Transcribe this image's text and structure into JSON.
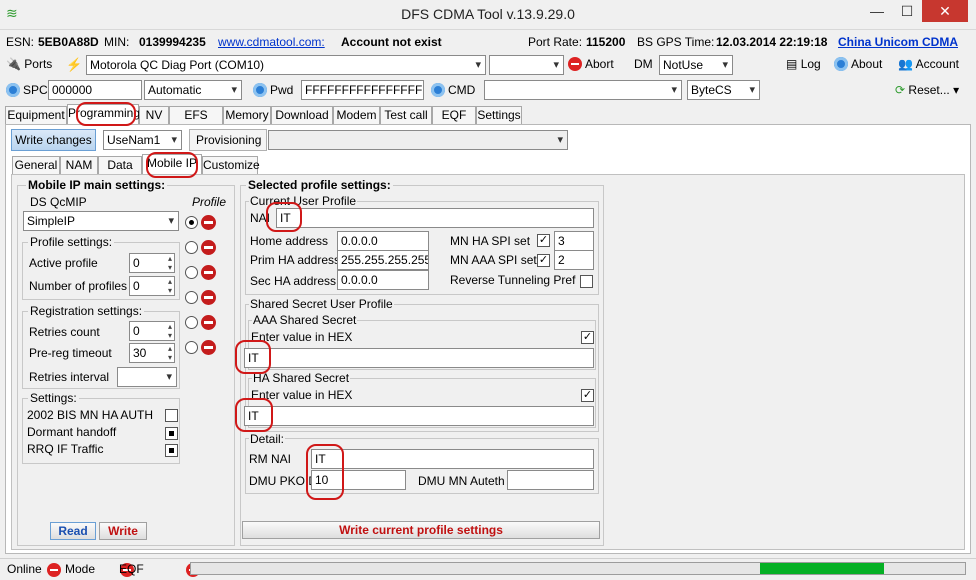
{
  "window": {
    "title": "DFS CDMA Tool v.13.9.29.0",
    "minimize": "—",
    "maximize": "☐",
    "close": "✕"
  },
  "info": {
    "esn_label": "ESN:",
    "esn": "5EB0A88D",
    "min_label": "MIN:",
    "min": "0139994235",
    "link": "www.cdmatool.com:",
    "account": "Account not exist",
    "port_rate_label": "Port Rate:",
    "port_rate": "115200",
    "gps_label": "BS GPS Time:",
    "gps": "12.03.2014 22:19:18",
    "carrier": "China Unicom CDMA"
  },
  "toolbar1": {
    "ports": "Ports",
    "port_value": "Motorola QC Diag Port (COM10)",
    "abort": "Abort",
    "dm": "DM",
    "dm_value": "NotUse",
    "log": "Log",
    "about": "About",
    "account": "Account"
  },
  "toolbar2": {
    "spc": "SPC",
    "spc_value": "000000",
    "mode_value": "Automatic",
    "pwd": "Pwd",
    "pwd_value": "FFFFFFFFFFFFFFFF",
    "cmd": "CMD",
    "cmd_value": "",
    "bytecs": "ByteCS",
    "reset": "Reset..."
  },
  "tabs": [
    "Equipment",
    "Programming",
    "NV",
    "EFS",
    "Memory",
    "Download",
    "Modem",
    "Test call",
    "EQF",
    "Settings"
  ],
  "subbar": {
    "write_changes": "Write changes",
    "usenam": "UseNam1",
    "provisioning": "Provisioning"
  },
  "subtabs": [
    "General",
    "NAM",
    "Data",
    "Mobile IP",
    "Customize"
  ],
  "left": {
    "heading": "Mobile IP main settings:",
    "ds_qcmip": "DS QcMIP",
    "profile": "Profile",
    "mode_value": "SimpleIP",
    "profile_settings": "Profile settings:",
    "active_profile": "Active profile",
    "active_profile_value": "0",
    "num_profiles": "Number of profiles",
    "num_profiles_value": "0",
    "registration": "Registration settings:",
    "retries_count": "Retries count",
    "retries_count_value": "0",
    "prereg_timeout": "Pre-reg timeout",
    "prereg_timeout_value": "30",
    "retries_interval": "Retries interval",
    "settings": "Settings:",
    "bis_auth": "2002 BIS MN HA AUTH",
    "dormant": "Dormant handoff",
    "rrq": "RRQ IF Traffic",
    "read": "Read",
    "write": "Write"
  },
  "right": {
    "heading": "Selected profile settings:",
    "current_user": "Current User Profile",
    "nai": "NAI",
    "nai_value": "IT",
    "home_address": "Home address",
    "home_address_value": "0.0.0.0",
    "prim_ha": "Prim HA address",
    "prim_ha_value": "255.255.255.255",
    "sec_ha": "Sec HA address",
    "sec_ha_value": "0.0.0.0",
    "mn_ha_spi": "MN HA SPI set",
    "mn_ha_spi_value": "3",
    "mn_aaa_spi": "MN AAA SPI set",
    "mn_aaa_spi_value": "2",
    "reverse_tunneling": "Reverse Tunneling Pref",
    "shared_secret": "Shared Secret User Profile",
    "aaa_secret": "AAA Shared Secret",
    "enter_hex": "Enter value in HEX",
    "aaa_value": "IT",
    "ha_secret": "HA Shared Secret",
    "ha_value": "IT",
    "detail": "Detail:",
    "rm_nai": "RM NAI",
    "rm_nai_value": "IT",
    "dmu_pkoid": "DMU PKOID",
    "dmu_pkoid_value": "10",
    "dmu_mn_auth": "DMU MN Auteth",
    "write_profile": "Write current profile settings"
  },
  "status": {
    "online": "Online",
    "mode": "Mode",
    "eqf": "EQF",
    "progress": 0.16,
    "progress_start": 0.735
  },
  "colors": {
    "accent_red": "#d01818",
    "progress": "#06b025",
    "link": "#0033cc"
  }
}
